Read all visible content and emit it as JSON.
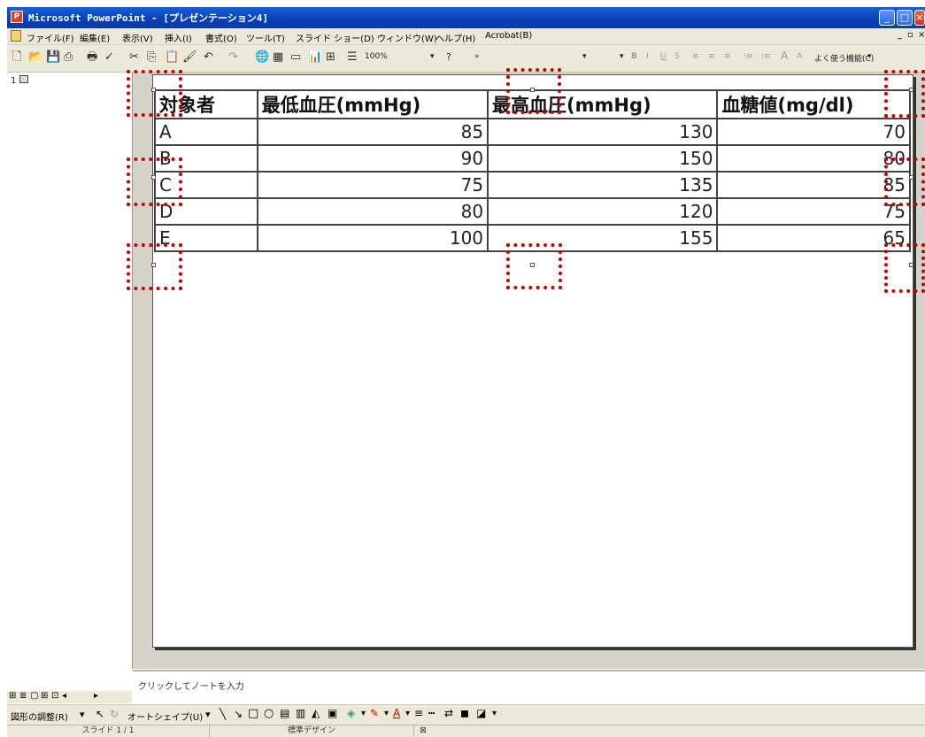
{
  "window": {
    "title": "Microsoft PowerPoint - [プレゼンテーション4]",
    "app_icon_glyph": "P"
  },
  "menu": {
    "items": [
      "ファイル(F)",
      "編集(E)",
      "表示(V)",
      "挿入(I)",
      "書式(O)",
      "ツール(T)",
      "スライド ショー(D)",
      "ウィンドウ(W)",
      "ヘルプ(H)",
      "Acrobat(B)"
    ]
  },
  "toolbar": {
    "zoom": "100%",
    "help_glyph": "?",
    "more_features": "よく使う機能(C)"
  },
  "slide_panel": {
    "thumb_number": "1"
  },
  "table": {
    "headers": [
      "対象者",
      "最低血圧(mmHg)",
      "最高血圧(mmHg)",
      "血糖値(mg/dl)"
    ],
    "rows": [
      [
        "A",
        "85",
        "130",
        "70"
      ],
      [
        "B",
        "90",
        "150",
        "80"
      ],
      [
        "C",
        "75",
        "135",
        "85"
      ],
      [
        "D",
        "80",
        "120",
        "75"
      ],
      [
        "E",
        "100",
        "155",
        "65"
      ]
    ]
  },
  "notes": {
    "placeholder": "クリックしてノートを入力"
  },
  "drawing_toolbar": {
    "draw_menu": "図形の調整(R)",
    "autoshape": "オートシェイプ(U)"
  },
  "status": {
    "slide": "スライド 1 / 1",
    "design": "標準デザイン"
  },
  "colors": {
    "title_bar": "#0a3fb6",
    "annotation": "#c00000"
  }
}
